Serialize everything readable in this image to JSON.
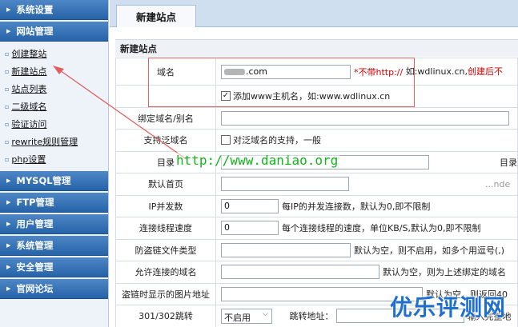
{
  "sidebar": {
    "sections": [
      {
        "label": "系统设置",
        "expanded": false
      },
      {
        "label": "网站管理",
        "expanded": true
      }
    ],
    "items": [
      {
        "label": "创建整站"
      },
      {
        "label": "新建站点"
      },
      {
        "label": "站点列表"
      },
      {
        "label": "二级域名"
      },
      {
        "label": "验证访问"
      },
      {
        "label": "rewrite规则管理"
      },
      {
        "label": "php设置"
      }
    ],
    "sections_after": [
      {
        "label": "MYSQL管理"
      },
      {
        "label": "FTP管理"
      },
      {
        "label": "用户管理"
      },
      {
        "label": "系统管理"
      },
      {
        "label": "安全管理"
      },
      {
        "label": "官网论坛"
      }
    ]
  },
  "main": {
    "tab_label": "新建站点",
    "section_title": "新建站点",
    "form": {
      "domain": {
        "label": "域名",
        "value_suffix": ".com",
        "note_prefix": "*不带http://",
        "note_example": " 如:wdlinux.cn,",
        "note_red": "创建后不"
      },
      "add_www": {
        "checked": true,
        "check_mark": "✓",
        "label": "添加www主机名，如:www.wdlinux.cn"
      },
      "alias": {
        "label": "绑定域名/别名"
      },
      "wildcard": {
        "label": "支持泛域名",
        "checked": false,
        "text": "对泛域名的支持，一般"
      },
      "dir": {
        "label": "目录",
        "right_label": "目录"
      },
      "default_page": {
        "label": "默认首页",
        "value": "",
        "note": "...nde"
      },
      "ip_concurrency": {
        "label": "IP并发数",
        "value": "0",
        "note": "每IP的并发连接数，默认为0,即不限制"
      },
      "conn_speed": {
        "label": "连接线程速度",
        "value": "0",
        "note": "每个连接线程的速度，单位KB/S,默认为0,即不限制"
      },
      "hotlink_types": {
        "label": "防盗链文件类型",
        "note": "默认为空，则不启用，如多个用逗号(,)"
      },
      "allowed_domains": {
        "label": "允许连接的域名",
        "note": "默认为空，则为上述绑定的域名"
      },
      "hotlink_image": {
        "label": "盗链时显示的图片地址",
        "note": "默认为空，则返回40"
      },
      "redirect": {
        "label": "301/302跳转",
        "select_value": "不启用",
        "chevron": "⌵",
        "target_label": "跳转地址：",
        "target_note": "输入完整地"
      }
    }
  },
  "watermarks": {
    "url": "http://www.daniao.org",
    "brand": "优乐评测网"
  },
  "colors": {
    "sidebar_header": "#2f6db3",
    "annotation_red": "#e06060",
    "watermark_green": "#11b31a",
    "watermark_blue": "#1e6fd0",
    "warning_red": "#d40000"
  }
}
